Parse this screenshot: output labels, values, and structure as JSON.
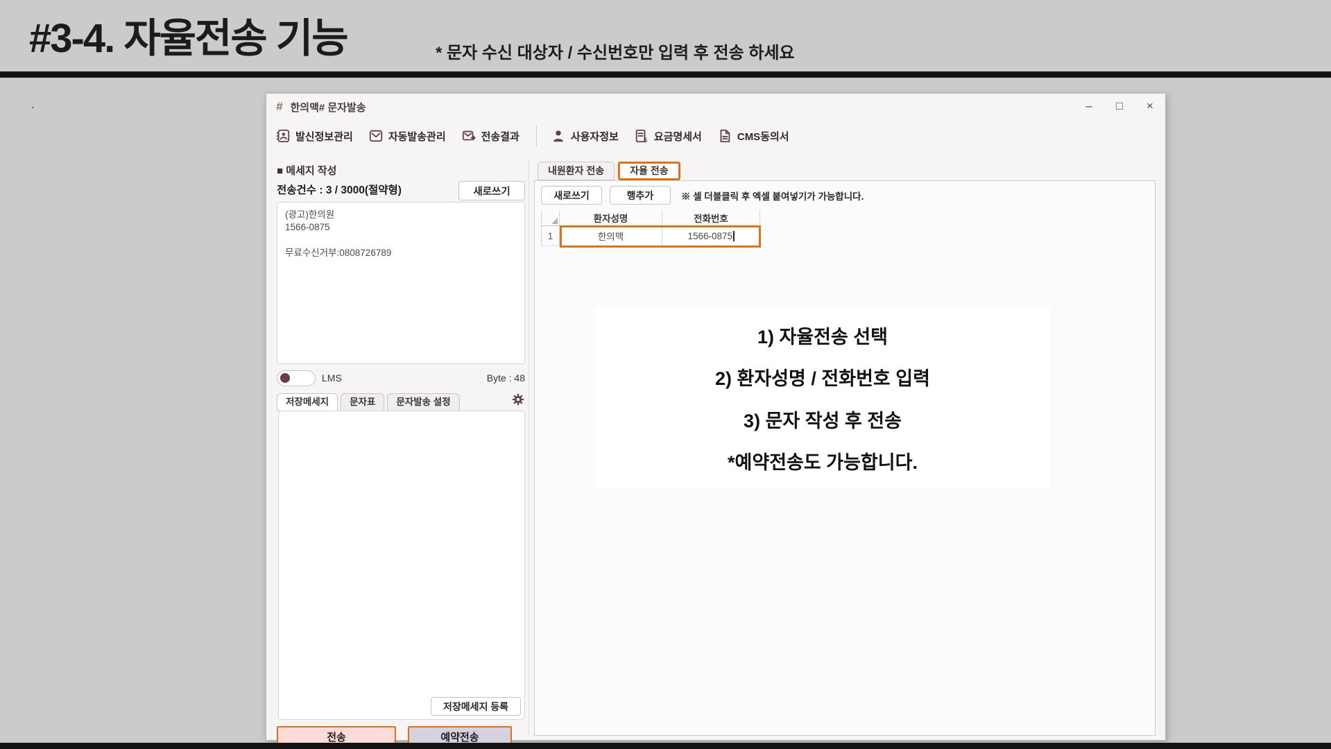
{
  "header": {
    "title": "#3-4. 자율전송 기능",
    "subtitle": "* 문자 수신 대상자 / 수신번호만 입력 후 전송 하세요",
    "dot": "."
  },
  "window": {
    "title": "한의맥# 문자발송",
    "app_icon": "#",
    "controls": {
      "minimize": "–",
      "maximize": "□",
      "close": "×"
    },
    "toolbar": {
      "items_left": [
        {
          "icon": "sender-info-icon",
          "label": "발신정보관리"
        },
        {
          "icon": "auto-send-icon",
          "label": "자동발송관리"
        },
        {
          "icon": "send-result-icon",
          "label": "전송결과"
        }
      ],
      "items_right": [
        {
          "icon": "user-info-icon",
          "label": "사용자정보"
        },
        {
          "icon": "billing-icon",
          "label": "요금명세서"
        },
        {
          "icon": "cms-doc-icon",
          "label": "CMS동의서"
        }
      ]
    }
  },
  "compose": {
    "section_title": "■ 메세지 작성",
    "count_label": "전송건수 : 3 / 3000(절약형)",
    "rewrite_button": "새로쓰기",
    "message_text": "(광고)한의원\n1566-0875\n\n무료수신거부:0808726789",
    "toggle_label": "LMS",
    "byte_label": "Byte : 48",
    "tabs": [
      {
        "label": "저장메세지"
      },
      {
        "label": "문자표"
      },
      {
        "label": "문자발송 설정"
      }
    ],
    "register_button": "저장메세지 등록",
    "send_button": "전송",
    "reserve_button": "예약전송"
  },
  "recipients": {
    "tabs": [
      {
        "label": "내원환자 전송"
      },
      {
        "label": "자율 전송"
      }
    ],
    "rewrite_button": "새로쓰기",
    "add_row_button": "행추가",
    "hint": "※ 셀 더블클릭 후 엑셀 붙여넣기가 가능합니다.",
    "table": {
      "columns": {
        "name": "환자성명",
        "phone": "전화번호"
      },
      "rows": [
        {
          "num": "1",
          "name": "한의맥",
          "phone": "1566-0875"
        }
      ]
    }
  },
  "instructions": {
    "lines": [
      "1) 자율전송 선택",
      "2) 환자성명 / 전화번호 입력",
      "3) 문자 작성 후 전송",
      "*예약전송도 가능합니다."
    ]
  },
  "colors": {
    "accent_orange": "#d9731f",
    "icon_plum": "#5f3f51",
    "send_pink": "#fcdbda",
    "reserve_lavender": "#d7d1dd",
    "page_gray": "#cbcbcb"
  }
}
